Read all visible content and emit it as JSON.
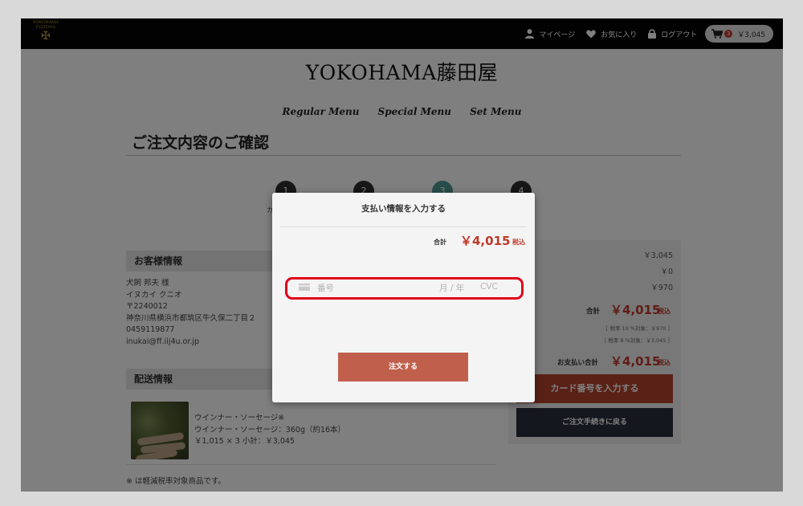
{
  "header": {
    "logo_text": "YOKOHAMA FUJITAYA",
    "nav": {
      "mypage": "マイページ",
      "favorites": "お気に入り",
      "logout": "ログアウト"
    },
    "cart": {
      "count": "3",
      "total": "￥3,045"
    }
  },
  "site": {
    "title": "YOKOHAMA藤田屋",
    "menu": [
      "Regular Menu",
      "Special Menu",
      "Set Menu"
    ]
  },
  "page": {
    "title": "ご注文内容のご確認",
    "steps": [
      "1",
      "2",
      "3",
      "4"
    ],
    "step_fragment": "カ"
  },
  "customer": {
    "heading": "お客様情報",
    "lines": [
      "犬飼 邦夫 様",
      "イヌカイ クニオ",
      "〒2240012",
      "神奈川県横浜市都筑区牛久保二丁目２",
      "0459119877",
      "inukai@ff.iij4u.or.jp"
    ]
  },
  "delivery": {
    "heading": "配送情報",
    "product": {
      "name": "ウインナー・ソーセージ※",
      "detail": "ウインナー・ソーセージ：360g（約16本）",
      "price_line": "￥1,015 × 3 小計：￥3,045"
    },
    "footnote": "※ は軽減税率対象商品です。"
  },
  "summary": {
    "subtotal": "￥3,045",
    "discount": "￥0",
    "shipping": "￥970",
    "left_fragment": "t",
    "total_label": "合計",
    "total": "￥4,015",
    "tax_label": "税込",
    "tax_note_10": "［ 税率 10 %対象：￥970 ］",
    "tax_note_8": "［ 税率 8 %対象：￥3,045 ］",
    "pay_label": "お支払い合計",
    "pay_total": "￥4,015",
    "card_button": "カード番号を入力する",
    "back_button": "ご注文手続きに戻る"
  },
  "modal": {
    "title": "支払い情報を入力する",
    "total_label": "合計",
    "total": "￥4,015",
    "tax_label": "税込",
    "card_placeholder": "番号",
    "expiry_placeholder": "月 / 年",
    "cvc_placeholder": "CVC",
    "submit": "注文する"
  },
  "colors": {
    "accent_red": "#c0392b",
    "highlight_red": "#e0001a",
    "active_step": "#4f9a94",
    "topbar": "#050505"
  }
}
